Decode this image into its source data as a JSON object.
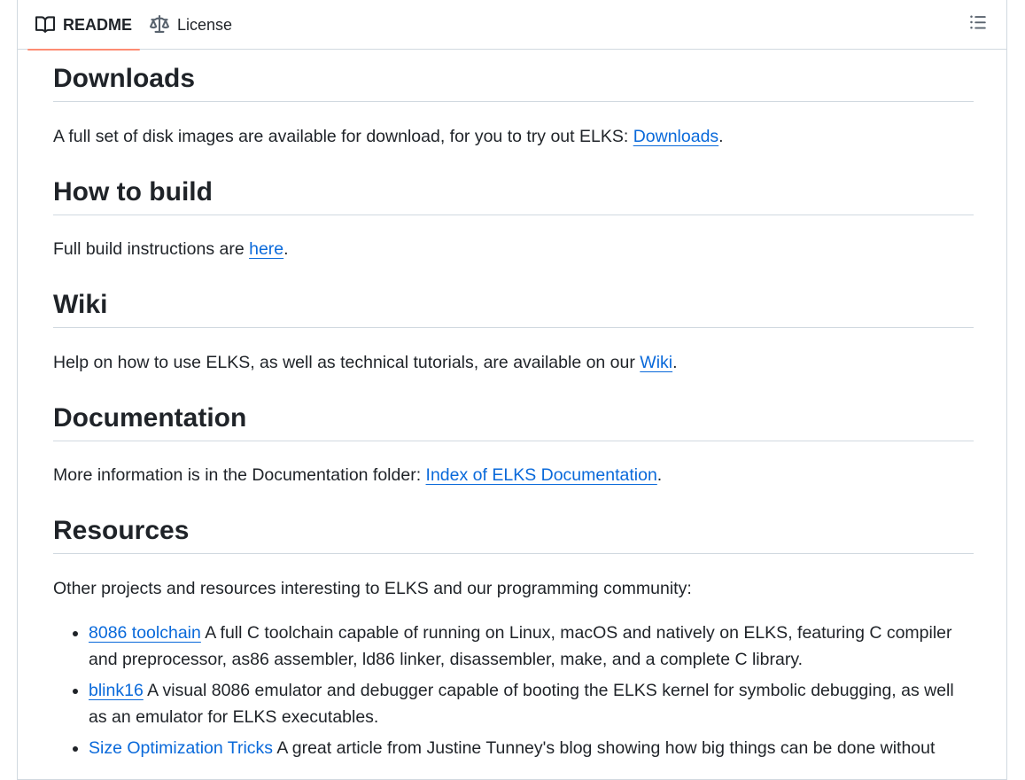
{
  "tabs": {
    "readme_label": "README",
    "license_label": "License"
  },
  "sections": {
    "downloads": {
      "heading": "Downloads",
      "text": "A full set of disk images are available for download, for you to try out ELKS: ",
      "link": "Downloads",
      "suffix": "."
    },
    "build": {
      "heading": "How to build",
      "text": "Full build instructions are ",
      "link": "here",
      "suffix": "."
    },
    "wiki": {
      "heading": "Wiki",
      "text": "Help on how to use ELKS, as well as technical tutorials, are available on our ",
      "link": "Wiki",
      "suffix": "."
    },
    "documentation": {
      "heading": "Documentation",
      "text": "More information is in the Documentation folder: ",
      "link": "Index of ELKS Documentation",
      "suffix": "."
    },
    "resources": {
      "heading": "Resources",
      "intro": "Other projects and resources interesting to ELKS and our programming community:",
      "items": [
        {
          "link": "8086 toolchain",
          "text": " A full C toolchain capable of running on Linux, macOS and natively on ELKS, featuring C compiler and preprocessor, as86 assembler, ld86 linker, disassembler, make, and a complete C library."
        },
        {
          "link": "blink16",
          "text": " A visual 8086 emulator and debugger capable of booting the ELKS kernel for symbolic debugging, as well as an emulator for ELKS executables."
        },
        {
          "link": "Size Optimization Tricks",
          "text": " A great article from Justine Tunney's blog showing how big things can be done without"
        }
      ]
    }
  },
  "colors": {
    "link": "#0969da",
    "text": "#1f2328",
    "border": "#d1d9e0",
    "tab_underline": "#fd8c73"
  },
  "icons": {
    "readme": "book-icon",
    "license": "law-scale-icon",
    "outline": "list-outline-icon"
  }
}
